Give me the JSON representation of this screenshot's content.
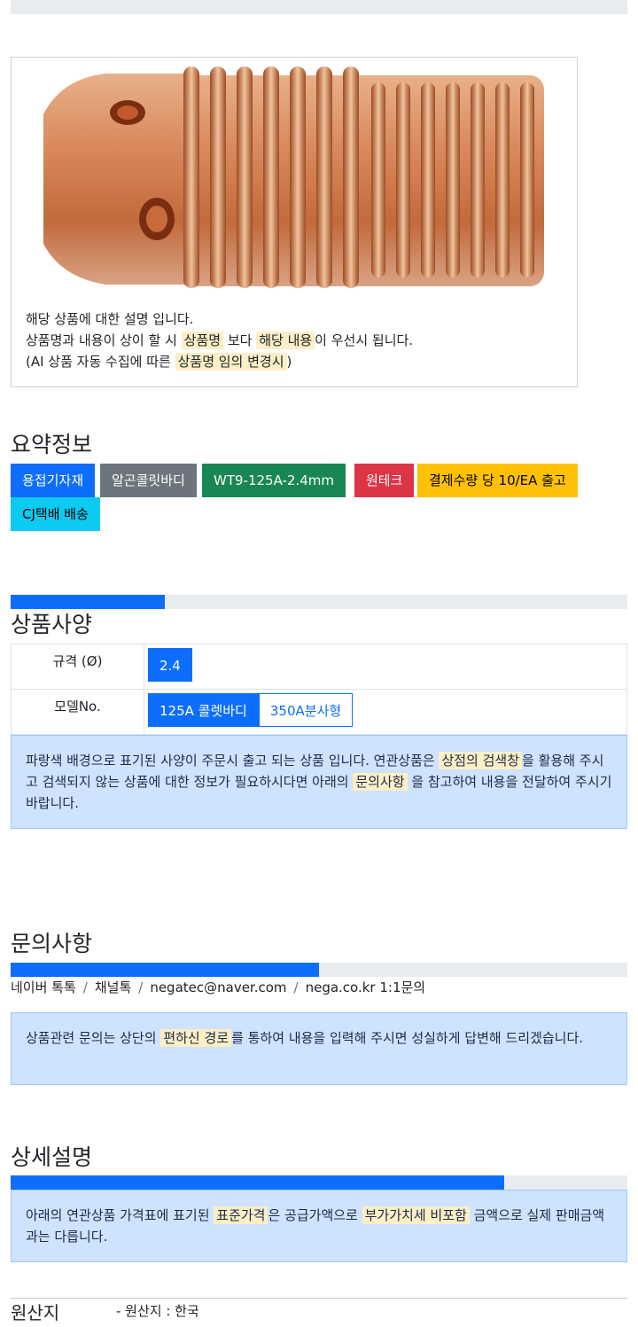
{
  "product": {
    "image_name": "welding-collet-body-photo",
    "desc_line1": "해당 상품에 대한 설명 입니다.",
    "desc_line2_pre": "상품명과 내용이 상이 할 시 ",
    "desc_line2_mark1": "상품명",
    "desc_line2_mid": " 보다 ",
    "desc_line2_mark2": "해당 내용",
    "desc_line2_post": "이 우선시 됩니다.",
    "desc_line3_pre": "(AI 상품 자동 수집에 따른 ",
    "desc_line3_mark": "상품명 임의 변경시",
    "desc_line3_post": ")"
  },
  "summary": {
    "title": "요약정보",
    "badges": [
      {
        "label": "용접기자재",
        "color": "#0d6efd",
        "text_color": "#ffffff"
      },
      {
        "label": "알곤콜릿바디",
        "color": "#6c757d",
        "text_color": "#ffffff"
      },
      {
        "label": "WT9-125A-2.4mm",
        "color": "#198754",
        "text_color": "#ffffff"
      },
      {
        "label": "원테크",
        "color": "#dc3545",
        "text_color": "#ffffff"
      },
      {
        "label": "결제수량 당 10/EA 출고",
        "color": "#ffc107",
        "text_color": "#000000"
      },
      {
        "label": "CJ택배 배송",
        "color": "#0dcaf0",
        "text_color": "#000000"
      }
    ]
  },
  "spec": {
    "title": "상품사양",
    "progress": 0.25,
    "rows": [
      {
        "label": "규격 (Ø)",
        "options": [
          {
            "text": "2.4",
            "selected": true
          }
        ]
      },
      {
        "label": "모델No.",
        "options": [
          {
            "text": "125A 콜렛바디",
            "selected": true
          },
          {
            "text": "350A분사형",
            "selected": false
          }
        ]
      }
    ],
    "note_pre": "파랑색 배경으로 표기된 사양이 주문시 출고 되는 상품 입니다. 연관상품은 ",
    "note_mark1": "상점의 검색창",
    "note_mid": "을 활용해 주시고 검색되지 않는 상품에 대한 정보가 필요하시다면 아래의 ",
    "note_mark2": "문의사항",
    "note_post": " 을 참고하여 내용을 전달하여 주시기 바랍니다."
  },
  "inquiry": {
    "title": "문의사항",
    "progress": 0.5,
    "contacts": [
      "네이버 톡톡",
      "채널톡",
      "negatec@naver.com",
      "nega.co.kr 1:1문의"
    ],
    "separator": "/",
    "note_pre": "상품관련 문의는 상단의 ",
    "note_mark": "편하신 경로",
    "note_post": "를 통하여 내용을 입력해 주시면 성실하게 답변해 드리겠습니다."
  },
  "detail": {
    "title": "상세설명",
    "progress": 0.8,
    "note_pre": "아래의 연관상품 가격표에 표기된 ",
    "note_mark1": "표준가격",
    "note_mid": "은 공급가액으로 ",
    "note_mark2": "부가가치세 비포함",
    "note_post": " 금액으로 실제 판매금액과는 다릅니다."
  },
  "origin": {
    "label": "원산지",
    "value": "- 원산지 : 한국"
  }
}
